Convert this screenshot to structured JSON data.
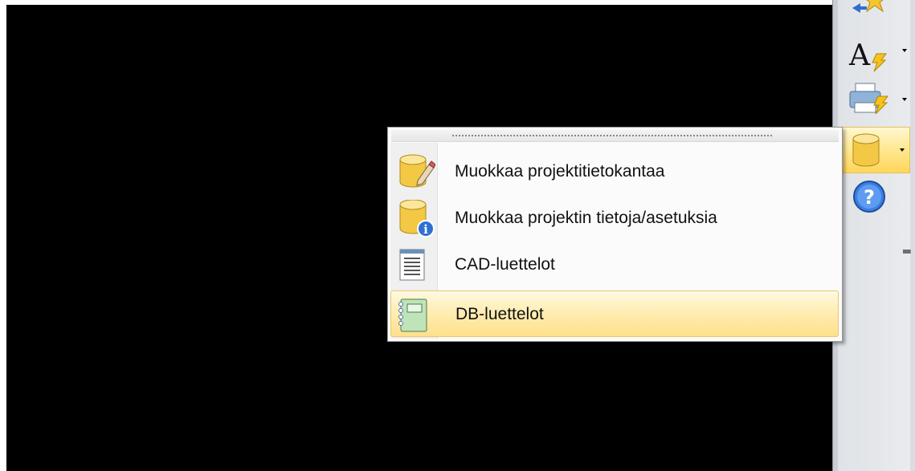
{
  "menu": {
    "items": [
      {
        "label": "Muokkaa projektitietokantaa",
        "icon": "database-edit-icon"
      },
      {
        "label": "Muokkaa projektin tietoja/asetuksia",
        "icon": "database-info-icon"
      },
      {
        "label": "CAD-luettelot",
        "icon": "list-document-icon"
      },
      {
        "label": "DB-luettelot",
        "icon": "notebook-list-icon"
      }
    ],
    "highlighted_item": "DB-luettelot"
  },
  "toolbar": {
    "buttons": [
      {
        "icon": "star-arrow-icon"
      },
      {
        "icon": "text-lightning-icon"
      },
      {
        "icon": "printer-lightning-icon"
      },
      {
        "icon": "database-icon",
        "state": "open"
      },
      {
        "icon": "help-icon"
      }
    ]
  },
  "colors": {
    "highlight": "#ffe08c",
    "canvas": "#000000",
    "toolbar": "#dfe2e6"
  }
}
